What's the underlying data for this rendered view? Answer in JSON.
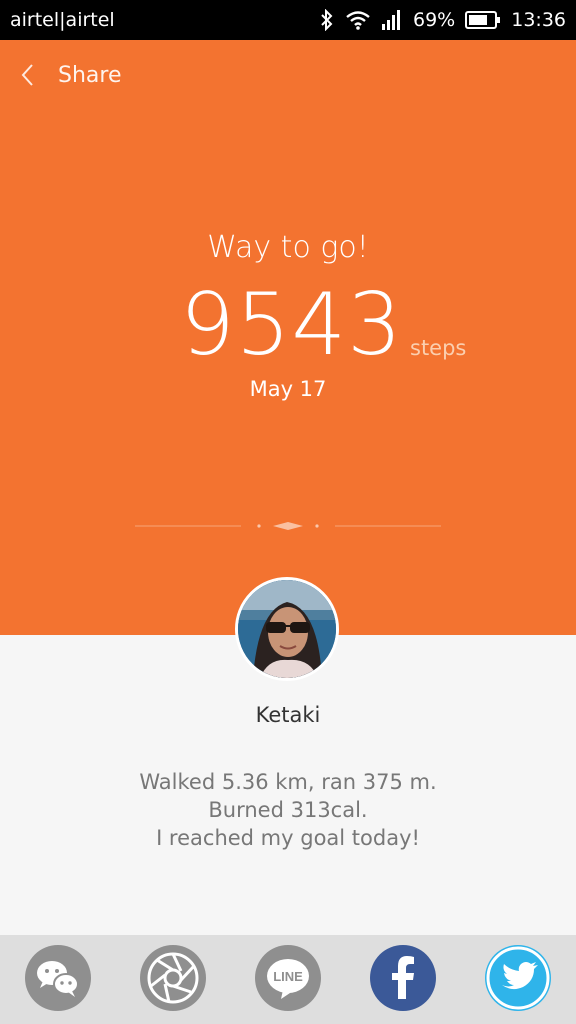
{
  "status": {
    "carrier": "airtel|airtel",
    "battery": "69%",
    "time": "13:36"
  },
  "header": {
    "title": "Share"
  },
  "hero": {
    "headline": "Way to go!",
    "steps": "9543",
    "unit": "steps",
    "date": "May 17"
  },
  "profile": {
    "name": "Ketaki"
  },
  "summary": {
    "line1": "Walked 5.36 km, ran 375 m.",
    "line2": "Burned 313cal.",
    "line3": "I reached my goal today!"
  },
  "share_targets": [
    {
      "label": "WeChat",
      "icon": "wechat-icon"
    },
    {
      "label": "Moments",
      "icon": "camera-aperture-icon"
    },
    {
      "label": "LINE",
      "icon": "line-icon"
    },
    {
      "label": "f",
      "icon": "facebook-icon"
    },
    {
      "label": "Twitter",
      "icon": "twitter-bird-icon"
    }
  ],
  "colors": {
    "accent": "#f37330",
    "facebook": "#3b5998",
    "twitter": "#2fb4ea",
    "sharebar": "#dedede"
  }
}
